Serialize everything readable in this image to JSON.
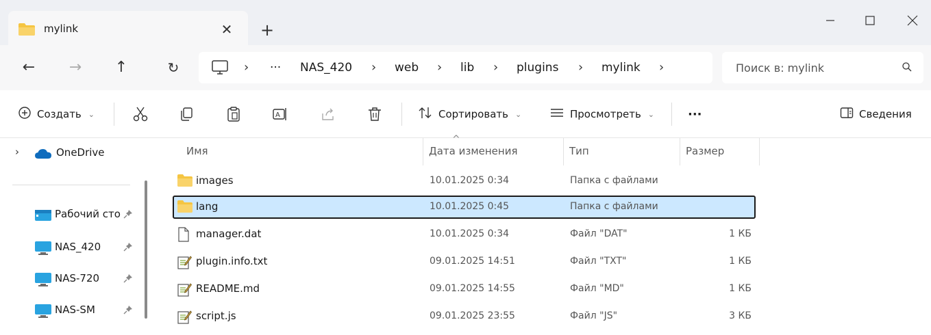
{
  "window": {
    "tab_title": "mylink",
    "new_tab": "+",
    "close_tab": "✕"
  },
  "nav": {
    "back": "←",
    "forward": "→",
    "up": "↑",
    "refresh": "↻"
  },
  "breadcrumb": {
    "overflow": "···",
    "items": [
      "NAS_420",
      "web",
      "lib",
      "plugins",
      "mylink"
    ],
    "separator": "›"
  },
  "search": {
    "placeholder": "Поиск в: mylink"
  },
  "toolbar": {
    "create_label": "Создать",
    "sort_label": "Сортировать",
    "view_label": "Просмотреть",
    "more_label": "···",
    "details_label": "Сведения",
    "caret": "⌄"
  },
  "sidebar": {
    "onedrive": "OneDrive",
    "quick": [
      {
        "label": "Рабочий сто"
      },
      {
        "label": "NAS_420"
      },
      {
        "label": "NAS-720"
      },
      {
        "label": "NAS-SM"
      }
    ]
  },
  "columns": {
    "name": "Имя",
    "date": "Дата изменения",
    "type": "Тип",
    "size": "Размер"
  },
  "files": [
    {
      "name": "images",
      "date": "10.01.2025 0:34",
      "type": "Папка с файлами",
      "size": "",
      "kind": "folder"
    },
    {
      "name": "lang",
      "date": "10.01.2025 0:45",
      "type": "Папка с файлами",
      "size": "",
      "kind": "folder"
    },
    {
      "name": "manager.dat",
      "date": "10.01.2025 0:34",
      "type": "Файл \"DAT\"",
      "size": "1 КБ",
      "kind": "file"
    },
    {
      "name": "plugin.info.txt",
      "date": "09.01.2025 14:51",
      "type": "Файл \"TXT\"",
      "size": "1 КБ",
      "kind": "text"
    },
    {
      "name": "README.md",
      "date": "09.01.2025 14:55",
      "type": "Файл \"MD\"",
      "size": "1 КБ",
      "kind": "text"
    },
    {
      "name": "script.js",
      "date": "09.01.2025 23:55",
      "type": "Файл \"JS\"",
      "size": "3 КБ",
      "kind": "text"
    }
  ],
  "colors": {
    "selection": "#cce8ff",
    "folder": "#f5c542",
    "accent": "#0067c0"
  }
}
